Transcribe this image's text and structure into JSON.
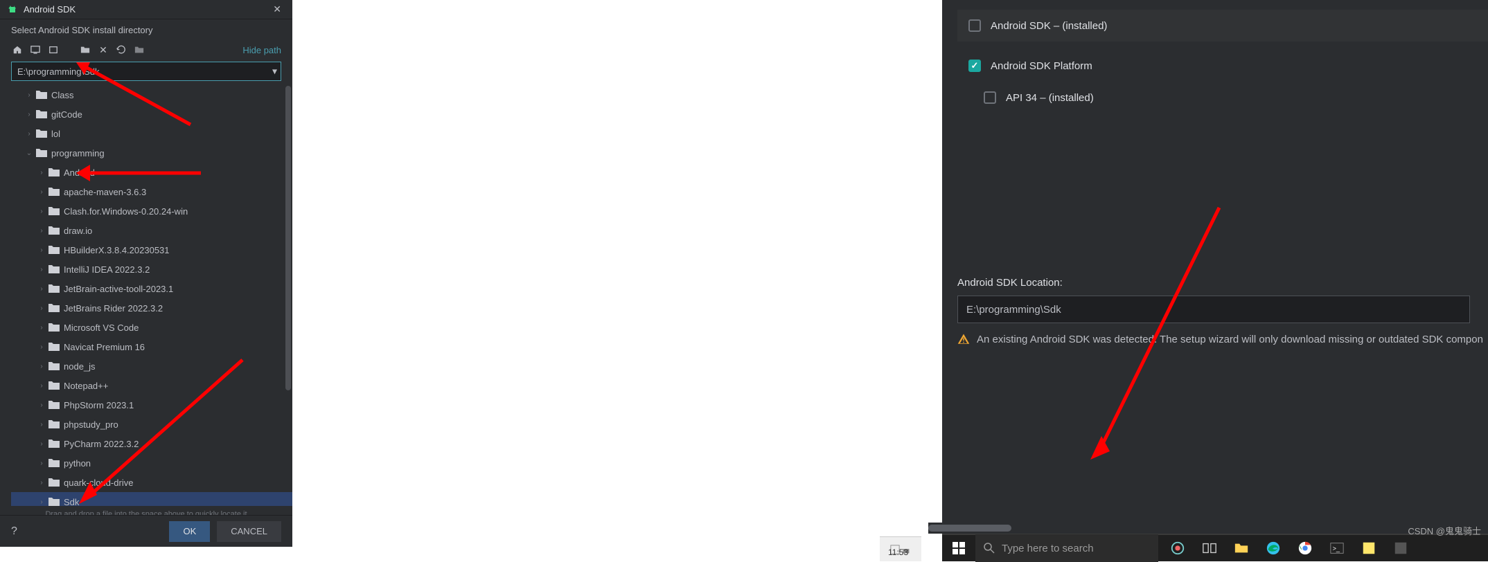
{
  "dialog": {
    "title": "Android SDK",
    "subtitle": "Select Android SDK install directory",
    "hide_path_label": "Hide path",
    "path_value": "E:\\programming\\Sdk",
    "drag_hint": "Drag and drop a file into the space above to quickly locate it",
    "ok_label": "OK",
    "cancel_label": "CANCEL",
    "help_label": "?",
    "tree": [
      {
        "label": "Class",
        "indent": 1,
        "expanded": false
      },
      {
        "label": "gitCode",
        "indent": 1,
        "expanded": false
      },
      {
        "label": "lol",
        "indent": 1,
        "expanded": false
      },
      {
        "label": "programming",
        "indent": 1,
        "expanded": true
      },
      {
        "label": "Android",
        "indent": 2,
        "expanded": false
      },
      {
        "label": "apache-maven-3.6.3",
        "indent": 2,
        "expanded": false
      },
      {
        "label": "Clash.for.Windows-0.20.24-win",
        "indent": 2,
        "expanded": false
      },
      {
        "label": "draw.io",
        "indent": 2,
        "expanded": false
      },
      {
        "label": "HBuilderX.3.8.4.20230531",
        "indent": 2,
        "expanded": false
      },
      {
        "label": "IntelliJ IDEA 2022.3.2",
        "indent": 2,
        "expanded": false
      },
      {
        "label": "JetBrain-active-tooll-2023.1",
        "indent": 2,
        "expanded": false
      },
      {
        "label": "JetBrains Rider 2022.3.2",
        "indent": 2,
        "expanded": false
      },
      {
        "label": "Microsoft VS Code",
        "indent": 2,
        "expanded": false
      },
      {
        "label": "Navicat Premium 16",
        "indent": 2,
        "expanded": false
      },
      {
        "label": "node_js",
        "indent": 2,
        "expanded": false
      },
      {
        "label": "Notepad++",
        "indent": 2,
        "expanded": false
      },
      {
        "label": "PhpStorm 2023.1",
        "indent": 2,
        "expanded": false
      },
      {
        "label": "phpstudy_pro",
        "indent": 2,
        "expanded": false
      },
      {
        "label": "PyCharm 2022.3.2",
        "indent": 2,
        "expanded": false
      },
      {
        "label": "python",
        "indent": 2,
        "expanded": false
      },
      {
        "label": "quark-cloud-drive",
        "indent": 2,
        "expanded": false
      },
      {
        "label": "Sdk",
        "indent": 2,
        "expanded": false,
        "selected": true
      }
    ]
  },
  "right": {
    "items": [
      {
        "label": "Android SDK – (installed)",
        "checked": false,
        "bg": true
      },
      {
        "label": "Android SDK Platform",
        "checked": true,
        "bg": false
      },
      {
        "label": "API 34 – (installed)",
        "checked": false,
        "bg": false,
        "sub": true
      }
    ],
    "location_label": "Android SDK Location:",
    "location_value": "E:\\programming\\Sdk",
    "warning_text": "An existing Android SDK was detected. The setup wizard will only download missing or outdated SDK compon"
  },
  "taskbar": {
    "search_placeholder": "Type here to search",
    "watermark": "CSDN @鬼鬼骑士",
    "clock": "11:53"
  }
}
